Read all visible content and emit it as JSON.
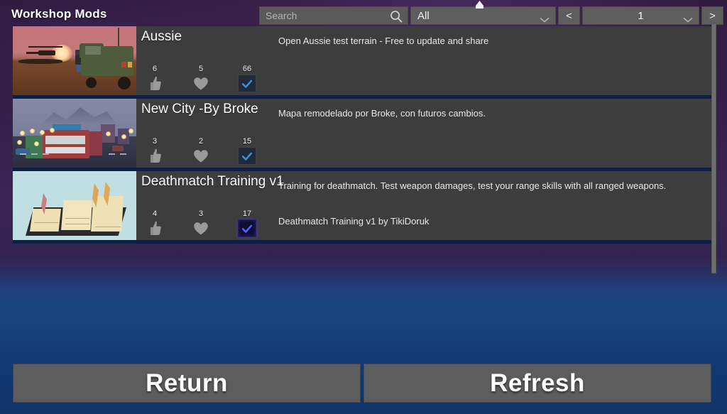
{
  "header": {
    "title": "Workshop Mods"
  },
  "toolbar": {
    "search": {
      "value": "",
      "placeholder": "Search",
      "icon": "search-icon"
    },
    "filter": {
      "selected": "All",
      "icon": "chevron-down-icon"
    },
    "prev_label": "<",
    "next_label": ">",
    "page": {
      "current": "1",
      "icon": "chevron-down-icon"
    }
  },
  "mods": [
    {
      "title": "Aussie",
      "description": "Open Aussie test terrain - Free to update and share",
      "thumbnail": "aussie-desert-sunset-thumbnail",
      "stats": {
        "likes": "6",
        "favorites": "5",
        "subscribers": "66"
      },
      "subscribed": true,
      "highlighted": false
    },
    {
      "title": "New City -By Broke",
      "description": "Mapa remodelado por Broke, con futuros cambios.",
      "thumbnail": "new-city-street-thumbnail",
      "stats": {
        "likes": "3",
        "favorites": "2",
        "subscribers": "15"
      },
      "subscribed": true,
      "highlighted": false
    },
    {
      "title": "Deathmatch Training v1",
      "description": "Training for deathmatch. Test weapon damages, test your range skills with all ranged weapons.\n\nDeathmatch Training v1 by TikiDoruk",
      "thumbnail": "deathmatch-training-range-thumbnail",
      "stats": {
        "likes": "4",
        "favorites": "3",
        "subscribers": "17"
      },
      "subscribed": true,
      "highlighted": true
    }
  ],
  "footer": {
    "return_label": "Return",
    "refresh_label": "Refresh"
  },
  "colors": {
    "accent_check": "#3b8fdd",
    "accent_check_glow": "#4a63ff",
    "panel": "#3d3d3d",
    "list_background": "#0d1f42",
    "control": "#5e5e5e"
  }
}
